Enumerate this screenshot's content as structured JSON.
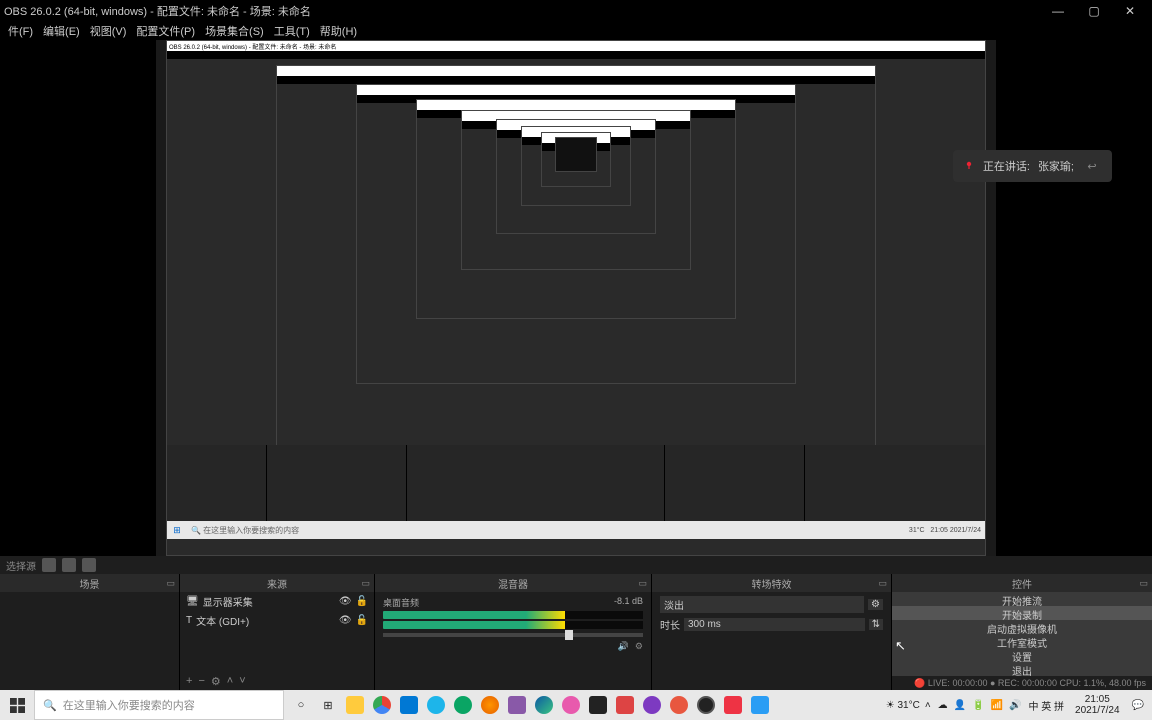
{
  "window": {
    "title": "OBS 26.0.2 (64-bit, windows) - 配置文件: 未命名 - 场景: 未命名",
    "min": "—",
    "max": "▢",
    "close": "✕"
  },
  "menu": {
    "file": "件(F)",
    "edit": "编辑(E)",
    "view": "视图(V)",
    "profile": "配置文件(P)",
    "sceneCol": "场景集合(S)",
    "tools": "工具(T)",
    "help": "帮助(H)"
  },
  "speaking": {
    "label": "正在讲话:",
    "name": "张家瑜;"
  },
  "toolbar": {
    "noSource": "选择源"
  },
  "panels": {
    "scenes": {
      "title": "场景",
      "footer_add": "+",
      "footer_del": "−",
      "footer_up": "˄",
      "footer_down": "˅"
    },
    "sources": {
      "title": "来源",
      "items": [
        {
          "icon": "🖥",
          "name": "显示器采集",
          "vis": "👁",
          "lock": "🔓"
        },
        {
          "icon": "T",
          "name": "文本 (GDI+)",
          "vis": "👁",
          "lock": "🔓"
        }
      ]
    },
    "mixer": {
      "title": "混音器",
      "channel": "桌面音频",
      "db": "-8.1 dB"
    },
    "transitions": {
      "title": "转场特效",
      "mode": "淡出",
      "durLabel": "时长",
      "dur": "300 ms"
    },
    "controls": {
      "title": "控件",
      "items": [
        "开始推流",
        "开始录制",
        "启动虚拟摄像机",
        "工作室模式",
        "设置",
        "退出"
      ]
    }
  },
  "status": "🔴 LIVE: 00:00:00 ● REC: 00:00:00   CPU: 1.1%, 48.00 fps",
  "taskbar": {
    "search_ph": "在这里输入你要搜索的内容",
    "weather": "31°C",
    "ime": "中 英 拼",
    "time": "21:05",
    "date": "2021/7/24"
  }
}
